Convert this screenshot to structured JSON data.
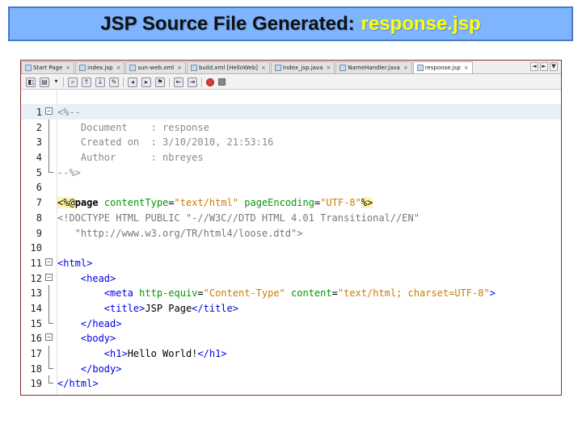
{
  "banner": {
    "prefix": "JSP Source File Generated:",
    "filename": "response.jsp"
  },
  "tabs": [
    {
      "label": "Start Page",
      "active": false
    },
    {
      "label": "index.jsp",
      "active": false
    },
    {
      "label": "sun-web.xml",
      "active": false
    },
    {
      "label": "build.xml [HelloWeb]",
      "active": false
    },
    {
      "label": "index_jsp.java",
      "active": false
    },
    {
      "label": "NameHandler.java",
      "active": false
    },
    {
      "label": "response.jsp",
      "active": true
    }
  ],
  "tab_nav": {
    "left": "◄",
    "right": "►",
    "menu": "▼"
  },
  "toolbar_icons": [
    "toggle-source-icon",
    "history-icon",
    "dropdown-icon",
    "find-icon",
    "find-prev-icon",
    "find-next-icon",
    "toggle-highlight-icon",
    "prev-bookmark-icon",
    "next-bookmark-icon",
    "toggle-bookmark-icon",
    "shift-left-icon",
    "shift-right-icon",
    "start-macro-icon",
    "stop-macro-icon"
  ],
  "lines": [
    {
      "n": "1",
      "fold": "open",
      "parts": [
        {
          "c": "c-comment",
          "t": "<%--"
        }
      ]
    },
    {
      "n": "2",
      "parts": [
        {
          "c": "c-comment",
          "t": "    Document    : response"
        }
      ]
    },
    {
      "n": "3",
      "parts": [
        {
          "c": "c-comment",
          "t": "    Created on  : 3/10/2010, 21:53:16"
        }
      ]
    },
    {
      "n": "4",
      "parts": [
        {
          "c": "c-comment",
          "t": "    Author      : nbreyes"
        }
      ]
    },
    {
      "n": "5",
      "fold": "end",
      "parts": [
        {
          "c": "c-comment",
          "t": "--%>"
        }
      ]
    },
    {
      "n": "6",
      "parts": []
    },
    {
      "n": "7",
      "parts": [
        {
          "c": "c-delim",
          "t": "<%@"
        },
        {
          "c": "c-dir",
          "t": "page"
        },
        {
          "c": "c-text",
          "t": " "
        },
        {
          "c": "c-attr",
          "t": "contentType"
        },
        {
          "c": "c-text",
          "t": "="
        },
        {
          "c": "c-str",
          "t": "\"text/html\""
        },
        {
          "c": "c-text",
          "t": " "
        },
        {
          "c": "c-attr",
          "t": "pageEncoding"
        },
        {
          "c": "c-text",
          "t": "="
        },
        {
          "c": "c-str",
          "t": "\"UTF-8\""
        },
        {
          "c": "c-delim",
          "t": "%>"
        }
      ]
    },
    {
      "n": "8",
      "parts": [
        {
          "c": "c-doctype",
          "t": "<!DOCTYPE HTML PUBLIC \"-//W3C//DTD HTML 4.01 Transitional//EN\""
        }
      ]
    },
    {
      "n": "9",
      "parts": [
        {
          "c": "c-doctype",
          "t": "   \"http://www.w3.org/TR/html4/loose.dtd\">"
        }
      ]
    },
    {
      "n": "10",
      "parts": []
    },
    {
      "n": "11",
      "fold": "open",
      "parts": [
        {
          "c": "c-tag",
          "t": "<html>"
        }
      ]
    },
    {
      "n": "12",
      "fold": "open",
      "parts": [
        {
          "c": "c-text",
          "t": "    "
        },
        {
          "c": "c-tag",
          "t": "<head>"
        }
      ]
    },
    {
      "n": "13",
      "parts": [
        {
          "c": "c-text",
          "t": "        "
        },
        {
          "c": "c-tag",
          "t": "<meta"
        },
        {
          "c": "c-text",
          "t": " "
        },
        {
          "c": "c-attr",
          "t": "http-equiv"
        },
        {
          "c": "c-text",
          "t": "="
        },
        {
          "c": "c-str",
          "t": "\"Content-Type\""
        },
        {
          "c": "c-text",
          "t": " "
        },
        {
          "c": "c-attr",
          "t": "content"
        },
        {
          "c": "c-text",
          "t": "="
        },
        {
          "c": "c-str",
          "t": "\"text/html; charset=UTF-8\""
        },
        {
          "c": "c-tag",
          "t": ">"
        }
      ]
    },
    {
      "n": "14",
      "parts": [
        {
          "c": "c-text",
          "t": "        "
        },
        {
          "c": "c-tag",
          "t": "<title>"
        },
        {
          "c": "c-text",
          "t": "JSP Page"
        },
        {
          "c": "c-tag",
          "t": "</title>"
        }
      ]
    },
    {
      "n": "15",
      "fold": "end",
      "parts": [
        {
          "c": "c-text",
          "t": "    "
        },
        {
          "c": "c-tag",
          "t": "</head>"
        }
      ]
    },
    {
      "n": "16",
      "fold": "open",
      "parts": [
        {
          "c": "c-text",
          "t": "    "
        },
        {
          "c": "c-tag",
          "t": "<body>"
        }
      ]
    },
    {
      "n": "17",
      "parts": [
        {
          "c": "c-text",
          "t": "        "
        },
        {
          "c": "c-tag",
          "t": "<h1>"
        },
        {
          "c": "c-text",
          "t": "Hello World!"
        },
        {
          "c": "c-tag",
          "t": "</h1>"
        }
      ]
    },
    {
      "n": "18",
      "fold": "end",
      "parts": [
        {
          "c": "c-text",
          "t": "    "
        },
        {
          "c": "c-tag",
          "t": "</body>"
        }
      ]
    },
    {
      "n": "19",
      "fold": "end",
      "parts": [
        {
          "c": "c-tag",
          "t": "</html>"
        }
      ]
    }
  ],
  "highlighted_line": "1"
}
